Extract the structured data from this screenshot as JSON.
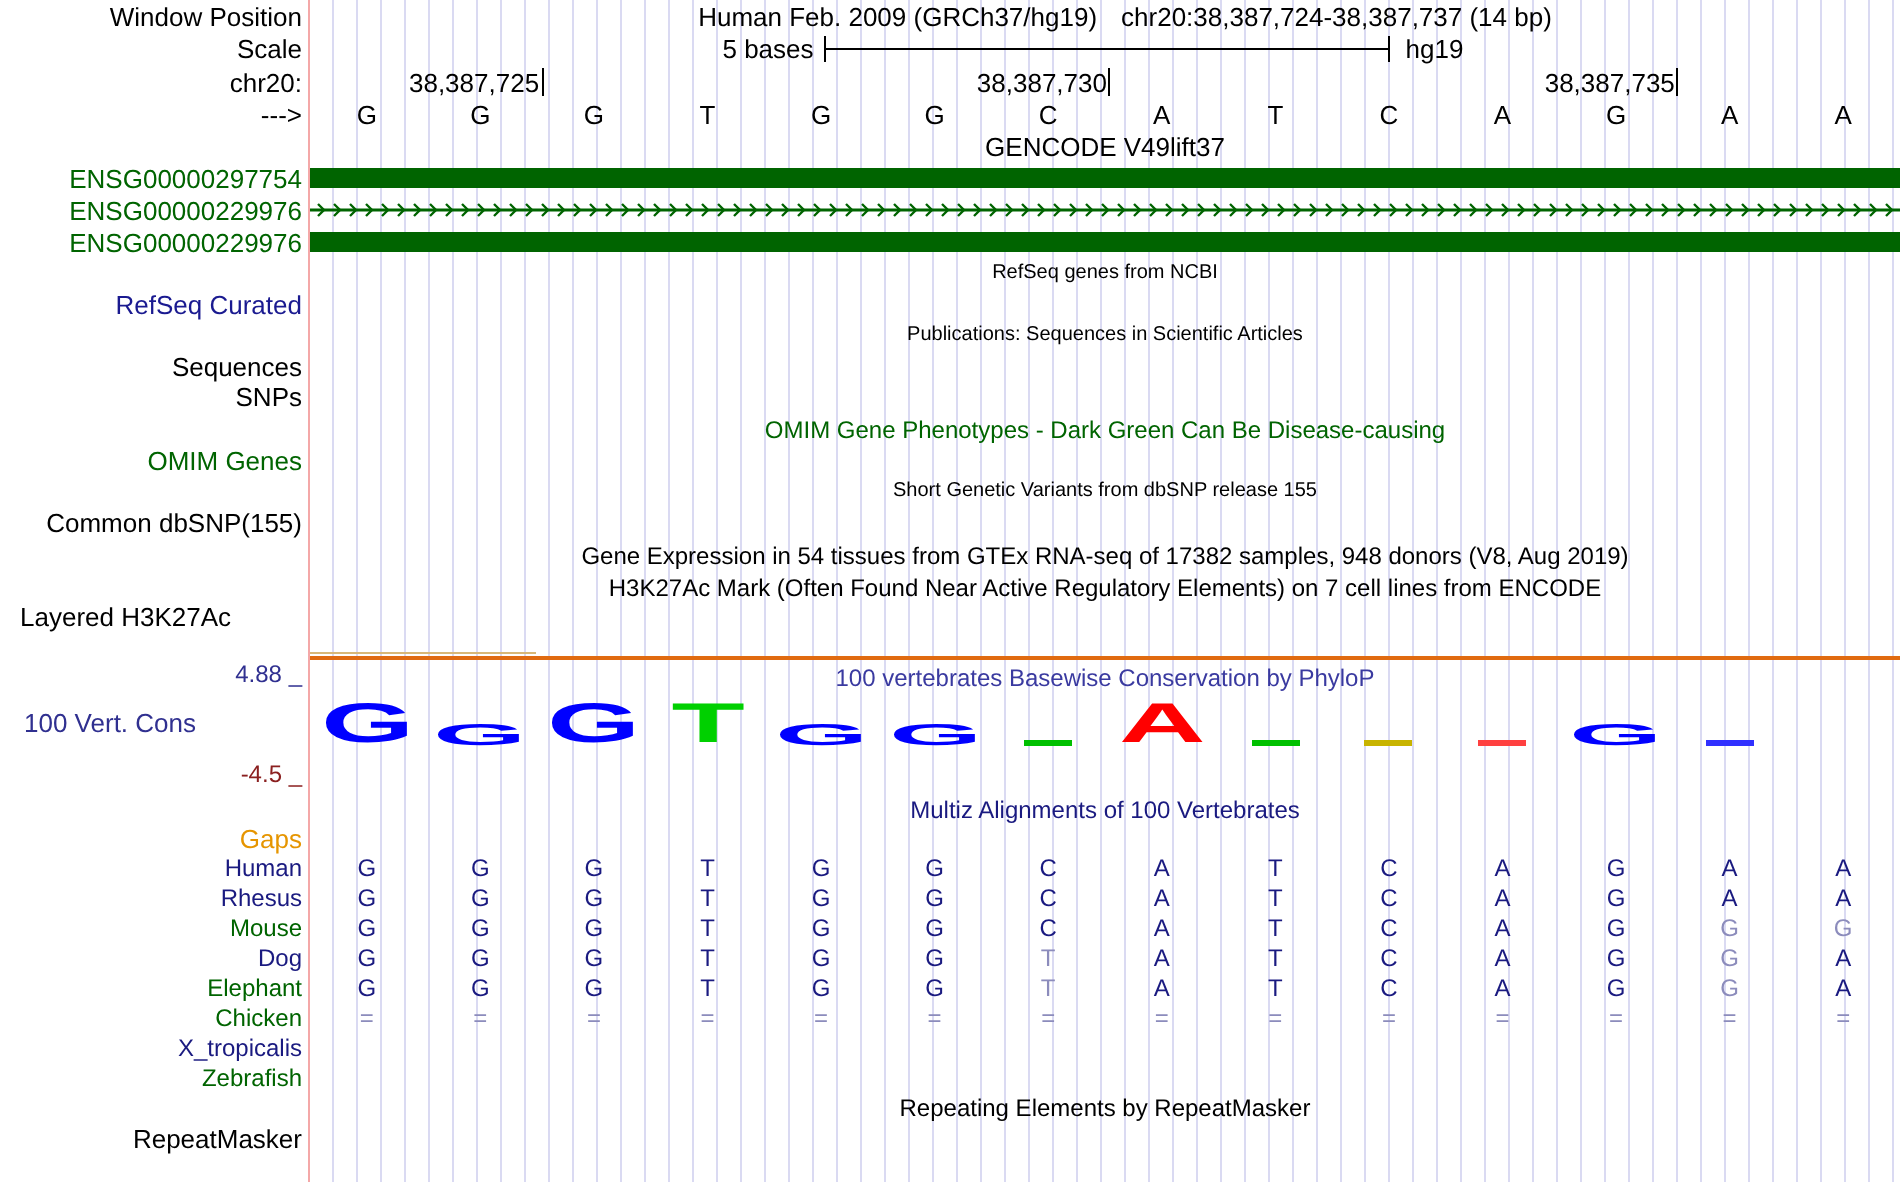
{
  "header": {
    "position_label": "Window Position",
    "assembly": "Human Feb. 2009 (GRCh37/hg19)",
    "range": "chr20:38,387,724-38,387,737 (14 bp)",
    "scale_label": "Scale",
    "scale_text": "5 bases",
    "scale_assembly": "hg19",
    "chrom_label": "chr20:",
    "ruler": [
      "38,387,725",
      "38,387,730",
      "38,387,735"
    ],
    "strand_label": "--->",
    "bases": [
      "G",
      "G",
      "G",
      "T",
      "G",
      "G",
      "C",
      "A",
      "T",
      "C",
      "A",
      "G",
      "A",
      "A"
    ]
  },
  "gencode": {
    "title": "GENCODE V49lift37",
    "genes": [
      {
        "name": "ENSG00000297754",
        "kind": "block"
      },
      {
        "name": "ENSG00000229976",
        "kind": "line"
      },
      {
        "name": "ENSG00000229976",
        "kind": "block"
      }
    ]
  },
  "refseq": {
    "title": "RefSeq genes from NCBI",
    "label": "RefSeq Curated"
  },
  "publications": {
    "title": "Publications: Sequences in Scientific Articles",
    "labels": [
      "Sequences",
      "SNPs"
    ]
  },
  "omim": {
    "title": "OMIM Gene Phenotypes - Dark Green Can Be Disease-causing",
    "label": "OMIM Genes"
  },
  "dbsnp": {
    "title": "Short Genetic Variants from dbSNP release 155",
    "label": "Common dbSNP(155)"
  },
  "gtex": {
    "title": "Gene Expression in 54 tissues from GTEx RNA-seq of 17382 samples, 948 donors (V8, Aug 2019)"
  },
  "h3k27ac": {
    "title": "H3K27Ac Mark (Often Found Near Active Regulatory Elements) on 7 cell lines from ENCODE",
    "label": "Layered H3K27Ac"
  },
  "conservation": {
    "title": "100 vertebrates Basewise Conservation by PhyloP",
    "label": "100 Vert. Cons",
    "y_max": "4.88 _",
    "y_min": "-4.5 _",
    "logo": [
      {
        "kind": "tall",
        "base": "G"
      },
      {
        "kind": "short",
        "base": "G"
      },
      {
        "kind": "tall",
        "base": "G"
      },
      {
        "kind": "tall",
        "base": "T"
      },
      {
        "kind": "short",
        "base": "G"
      },
      {
        "kind": "short",
        "base": "G"
      },
      {
        "kind": "mark",
        "color": "#00c000"
      },
      {
        "kind": "tall",
        "base": "A"
      },
      {
        "kind": "mark",
        "color": "#00c000"
      },
      {
        "kind": "mark",
        "color": "#c8b400"
      },
      {
        "kind": "mark",
        "color": "#ff4040"
      },
      {
        "kind": "short",
        "base": "G"
      },
      {
        "kind": "mark",
        "color": "#3030ff"
      }
    ]
  },
  "multiz": {
    "title": "Multiz Alignments of 100 Vertebrates",
    "gaps_label": "Gaps",
    "species": [
      {
        "name": "Human",
        "color": "#1a1a80",
        "bases": [
          {
            "base": "G",
            "faded": false
          },
          {
            "base": "G",
            "faded": false
          },
          {
            "base": "G",
            "faded": false
          },
          {
            "base": "T",
            "faded": false
          },
          {
            "base": "G",
            "faded": false
          },
          {
            "base": "G",
            "faded": false
          },
          {
            "base": "C",
            "faded": false
          },
          {
            "base": "A",
            "faded": false
          },
          {
            "base": "T",
            "faded": false
          },
          {
            "base": "C",
            "faded": false
          },
          {
            "base": "A",
            "faded": false
          },
          {
            "base": "G",
            "faded": false
          },
          {
            "base": "A",
            "faded": false
          },
          {
            "base": "A",
            "faded": false
          }
        ]
      },
      {
        "name": "Rhesus",
        "color": "#1a1a80",
        "bases": [
          {
            "base": "G",
            "faded": false
          },
          {
            "base": "G",
            "faded": false
          },
          {
            "base": "G",
            "faded": false
          },
          {
            "base": "T",
            "faded": false
          },
          {
            "base": "G",
            "faded": false
          },
          {
            "base": "G",
            "faded": false
          },
          {
            "base": "C",
            "faded": false
          },
          {
            "base": "A",
            "faded": false
          },
          {
            "base": "T",
            "faded": false
          },
          {
            "base": "C",
            "faded": false
          },
          {
            "base": "A",
            "faded": false
          },
          {
            "base": "G",
            "faded": false
          },
          {
            "base": "A",
            "faded": false
          },
          {
            "base": "A",
            "faded": false
          }
        ]
      },
      {
        "name": "Mouse",
        "color": "#006400",
        "bases": [
          {
            "base": "G",
            "faded": false
          },
          {
            "base": "G",
            "faded": false
          },
          {
            "base": "G",
            "faded": false
          },
          {
            "base": "T",
            "faded": false
          },
          {
            "base": "G",
            "faded": false
          },
          {
            "base": "G",
            "faded": false
          },
          {
            "base": "C",
            "faded": false
          },
          {
            "base": "A",
            "faded": false
          },
          {
            "base": "T",
            "faded": false
          },
          {
            "base": "C",
            "faded": false
          },
          {
            "base": "A",
            "faded": false
          },
          {
            "base": "G",
            "faded": false
          },
          {
            "base": "G",
            "faded": true
          },
          {
            "base": "G",
            "faded": true
          }
        ]
      },
      {
        "name": "Dog",
        "color": "#1a1a80",
        "bases": [
          {
            "base": "G",
            "faded": false
          },
          {
            "base": "G",
            "faded": false
          },
          {
            "base": "G",
            "faded": false
          },
          {
            "base": "T",
            "faded": false
          },
          {
            "base": "G",
            "faded": false
          },
          {
            "base": "G",
            "faded": false
          },
          {
            "base": "T",
            "faded": true
          },
          {
            "base": "A",
            "faded": false
          },
          {
            "base": "T",
            "faded": false
          },
          {
            "base": "C",
            "faded": false
          },
          {
            "base": "A",
            "faded": false
          },
          {
            "base": "G",
            "faded": false
          },
          {
            "base": "G",
            "faded": true
          },
          {
            "base": "A",
            "faded": false
          }
        ]
      },
      {
        "name": "Elephant",
        "color": "#006400",
        "bases": [
          {
            "base": "G",
            "faded": false
          },
          {
            "base": "G",
            "faded": false
          },
          {
            "base": "G",
            "faded": false
          },
          {
            "base": "T",
            "faded": false
          },
          {
            "base": "G",
            "faded": false
          },
          {
            "base": "G",
            "faded": false
          },
          {
            "base": "T",
            "faded": true
          },
          {
            "base": "A",
            "faded": false
          },
          {
            "base": "T",
            "faded": false
          },
          {
            "base": "C",
            "faded": false
          },
          {
            "base": "A",
            "faded": false
          },
          {
            "base": "G",
            "faded": false
          },
          {
            "base": "G",
            "faded": true
          },
          {
            "base": "A",
            "faded": false
          }
        ]
      },
      {
        "name": "Chicken",
        "color": "#006400",
        "bases": [
          {
            "base": "=",
            "faded": true
          },
          {
            "base": "=",
            "faded": true
          },
          {
            "base": "=",
            "faded": true
          },
          {
            "base": "=",
            "faded": true
          },
          {
            "base": "=",
            "faded": true
          },
          {
            "base": "=",
            "faded": true
          },
          {
            "base": "=",
            "faded": true
          },
          {
            "base": "=",
            "faded": true
          },
          {
            "base": "=",
            "faded": true
          },
          {
            "base": "=",
            "faded": true
          },
          {
            "base": "=",
            "faded": true
          },
          {
            "base": "=",
            "faded": true
          },
          {
            "base": "=",
            "faded": true
          },
          {
            "base": "=",
            "faded": true
          }
        ]
      },
      {
        "name": "X_tropicalis",
        "color": "#1a1a80"
      },
      {
        "name": "Zebrafish",
        "color": "#006400"
      }
    ]
  },
  "repeatmasker": {
    "title": "Repeating Elements by RepeatMasker",
    "label": "RepeatMasker"
  }
}
